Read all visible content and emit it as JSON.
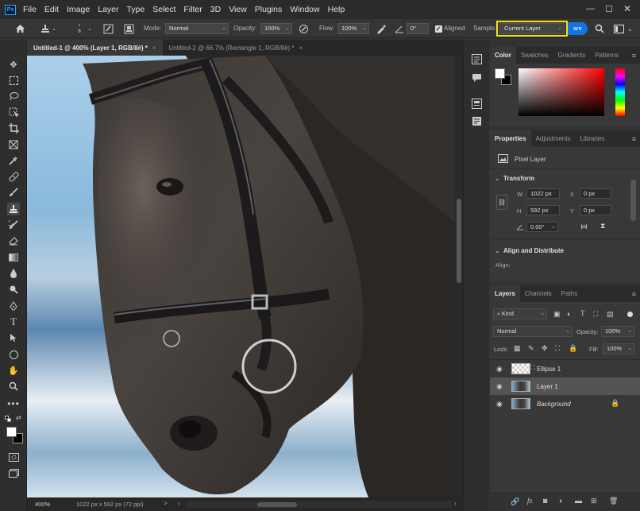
{
  "app": {
    "logo": "Ps"
  },
  "menu": [
    "File",
    "Edit",
    "Image",
    "Layer",
    "Type",
    "Select",
    "Filter",
    "3D",
    "View",
    "Plugins",
    "Window",
    "Help"
  ],
  "options_bar": {
    "brush_size": "6",
    "mode_label": "Mode:",
    "mode_value": "Normal",
    "opacity_label": "Opacity:",
    "opacity_value": "100%",
    "flow_label": "Flow:",
    "flow_value": "100%",
    "angle_value": "0°",
    "aligned_label": "Aligned",
    "aligned_checked": true,
    "sample_label": "Sample:",
    "sample_value": "Current Layer",
    "share_label": "are",
    "highlight_color": "#f5e40c",
    "accent_color": "#1473e6"
  },
  "doc_tabs": [
    {
      "label": "Untitled-1 @ 400% (Layer 1, RGB/8#) *",
      "close": "×",
      "active": true
    },
    {
      "label": "Untitled-2 @ 66.7% (Rectangle 1, RGB/8#) *",
      "close": "×",
      "active": false
    }
  ],
  "status": {
    "zoom": "400%",
    "doc_info": "1022 px x 592 px (72 ppi)",
    "arrow": ">"
  },
  "color_panel": {
    "tabs": [
      "Color",
      "Swatches",
      "Gradients",
      "Patterns"
    ]
  },
  "properties_panel": {
    "tabs": [
      "Properties",
      "Adjustments",
      "Libraries"
    ],
    "kind": "Pixel Layer",
    "transform_title": "Transform",
    "w_label": "W",
    "w_value": "1022 px",
    "h_label": "H",
    "h_value": "592 px",
    "x_label": "X",
    "x_value": "0 px",
    "y_label": "Y",
    "y_value": "0 px",
    "angle_value": "0.00°",
    "align_title": "Align and Distribute",
    "align_label": "Align:"
  },
  "layers_panel": {
    "tabs": [
      "Layers",
      "Channels",
      "Paths"
    ],
    "filter_kind": "Kind",
    "blend_mode": "Normal",
    "opacity_label": "Opacity:",
    "opacity_value": "100%",
    "lock_label": "Lock:",
    "fill_label": "Fill:",
    "fill_value": "100%",
    "layers": [
      {
        "name": "Ellipse 1",
        "selected": false,
        "locked": false
      },
      {
        "name": "Layer 1",
        "selected": true,
        "locked": false
      },
      {
        "name": "Background",
        "selected": false,
        "locked": true
      }
    ],
    "footer_icons": [
      "link-icon",
      "fx-icon",
      "mask-icon",
      "adjustment-icon",
      "group-icon",
      "new-layer-icon",
      "trash-icon"
    ]
  }
}
